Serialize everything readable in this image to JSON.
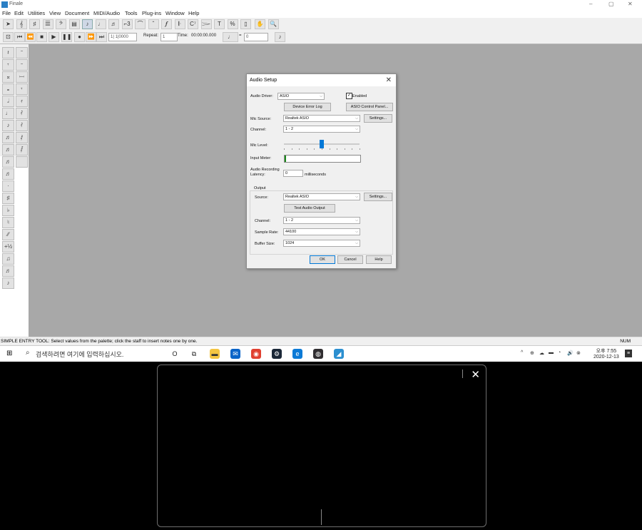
{
  "app": {
    "title": "Finale",
    "window_controls": [
      "–",
      "▢",
      "✕"
    ]
  },
  "menubar": [
    "File",
    "Edit",
    "Utilities",
    "View",
    "Document",
    "MIDI/Audio",
    "Tools",
    "Plug-ins",
    "Window",
    "Help"
  ],
  "toolbar1": {
    "tools": [
      "selection-tool-icon",
      "staff-tool-icon",
      "key-signature-icon",
      "time-signature-icon",
      "clef-tool-icon",
      "measure-tool-icon",
      "simple-entry-icon",
      "speedy-entry-icon",
      "hyperscribe-icon",
      "tuplet-tool-icon",
      "smart-shape-icon",
      "articulation-icon",
      "expression-tool-icon",
      "repeat-tool-icon",
      "chord-tool-icon",
      "lyrics-tool-icon",
      "text-tool-icon",
      "percent-tool-icon",
      "page-layout-icon",
      "hand-grabber-icon",
      "zoom-icon"
    ],
    "glyphs": [
      "➤",
      "𝄞",
      "♯",
      "𝄚",
      "𝄢",
      "▤",
      "♪",
      "♩",
      "♬",
      "⌐3",
      "⌒",
      "ˆ",
      "𝆑",
      "𝄆",
      "C⁷",
      "𝆓",
      "T",
      "%",
      "▯",
      "✋",
      "🔍"
    ]
  },
  "toolbar2": {
    "transport": [
      "⊡",
      "⏮",
      "⏪",
      "■",
      "▶",
      "❚❚",
      "●",
      "⏩",
      "⏭"
    ],
    "measure_value": "1| 1|0000",
    "repeat_label": "Repeat:",
    "repeat_value": "1",
    "time_label": "Time:",
    "time_value": "00:00:00.000",
    "tempo_value": "0"
  },
  "palette": {
    "items": [
      [
        "𝄽",
        "𝄻"
      ],
      [
        "𝄾",
        "𝄼"
      ],
      [
        "𝄪",
        "𝄩"
      ],
      [
        "𝅝",
        "𝄾"
      ],
      [
        "𝅗𝅥",
        "𝄿"
      ],
      [
        "♩",
        "𝅀"
      ],
      [
        "♪",
        "𝅀"
      ],
      [
        "♬",
        "𝅁"
      ],
      [
        "♬",
        "𝅂"
      ],
      [
        "♬",
        ""
      ],
      [
        "♬",
        ""
      ],
      [
        "·",
        ""
      ],
      [
        "♯",
        ""
      ],
      [
        "♭",
        ""
      ],
      [
        "♮",
        ""
      ],
      [
        "∕∕",
        ""
      ],
      [
        "+½",
        ""
      ],
      [
        "♫",
        ""
      ],
      [
        "♬",
        ""
      ],
      [
        "♪",
        ""
      ]
    ]
  },
  "status": {
    "text": "SIMPLE ENTRY TOOL: Select values from the palette; click the staff to insert notes one by one.",
    "num": "NUM"
  },
  "taskbar": {
    "search_placeholder": "검색하려면 여기에 입력하십시오.",
    "time": "오후 7:55",
    "date": "2020-12-13",
    "apps": [
      {
        "name": "cortana-icon",
        "glyph": "O",
        "color": "#ffffff",
        "fg": "#222"
      },
      {
        "name": "task-view-icon",
        "glyph": "⧉",
        "color": "#ffffff",
        "fg": "#222"
      },
      {
        "name": "file-explorer-icon",
        "glyph": "▬",
        "color": "#f4c542",
        "fg": "#333"
      },
      {
        "name": "mail-icon",
        "glyph": "✉",
        "color": "#0a64c8",
        "fg": "#fff"
      },
      {
        "name": "chrome-icon",
        "glyph": "◉",
        "color": "#e04030",
        "fg": "#fff"
      },
      {
        "name": "steam-icon",
        "glyph": "⚙",
        "color": "#1b2838",
        "fg": "#fff"
      },
      {
        "name": "edge-icon",
        "glyph": "e",
        "color": "#0c7ad6",
        "fg": "#fff"
      },
      {
        "name": "obs-icon",
        "glyph": "◍",
        "color": "#302e31",
        "fg": "#fff"
      },
      {
        "name": "finale-taskbar-icon",
        "glyph": "◢",
        "color": "#2b8fd0",
        "fg": "#fff"
      }
    ],
    "tray": [
      "^",
      "⊕",
      "☁",
      "▬",
      "◔",
      "🔊",
      "⊗"
    ]
  },
  "dialog": {
    "title": "Audio Setup",
    "audio_driver_label": "Audio Driver:",
    "audio_driver_value": "ASIO",
    "enabled_label": "Enabled",
    "enabled_checked": true,
    "device_error_log": "Device Error Log",
    "asio_control_panel": "ASIO Control Panel...",
    "mic_source_label": "Mic Source:",
    "mic_source_value": "Realtek ASIO",
    "settings_label": "Settings...",
    "channel_label": "Channel:",
    "channel_value": "1 - 2",
    "mic_level_label": "Mic Level:",
    "mic_level_fraction": 0.5,
    "input_meter_label": "Input Meter:",
    "latency_label_1": "Audio Recording",
    "latency_label_2": "Latency:",
    "latency_value": "0",
    "latency_unit": "milliseconds",
    "output_label": "Output",
    "source_label": "Source:",
    "source_value": "Realtek ASIO",
    "test_audio_output": "Test Audio Output",
    "out_channel_label": "Channel:",
    "out_channel_value": "1 - 2",
    "sample_rate_label": "Sample Rate:",
    "sample_rate_value": "44100",
    "buffer_size_label": "Buffer Size:",
    "buffer_size_value": "1024",
    "ok": "OK",
    "cancel": "Cancel",
    "help": "Help"
  }
}
